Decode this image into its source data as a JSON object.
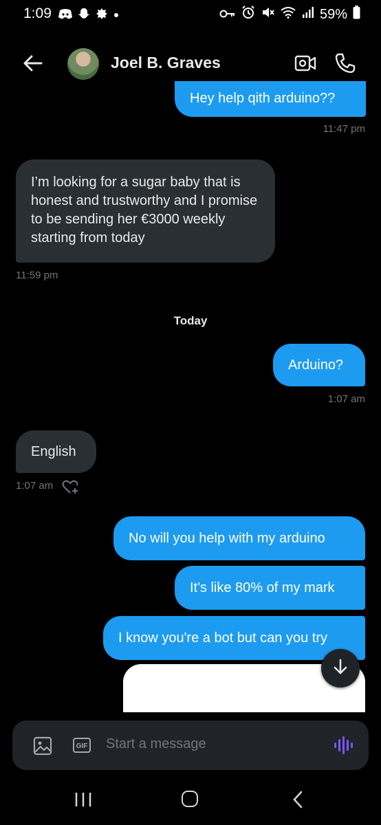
{
  "status_bar": {
    "time": "1:09",
    "battery": "59%"
  },
  "header": {
    "contact_name": "Joel B. Graves"
  },
  "messages": [
    {
      "text": "Hey help qith arduino??",
      "time": "11:47 pm"
    },
    {
      "text": "I’m looking for a sugar baby that is honest and trustworthy and I promise to be sending her €3000 weekly starting from today",
      "time": "11:59 pm"
    },
    {
      "text": "Arduino?",
      "time": "1:07 am"
    },
    {
      "text": "English",
      "time": "1:07 am"
    },
    {
      "text": "No will you help with my arduino"
    },
    {
      "text": "It's like 80% of my mark"
    },
    {
      "text": "I know you're a bot but can you try"
    }
  ],
  "day_divider": "Today",
  "composer": {
    "placeholder": "Start a message",
    "gif_label": "GIF"
  },
  "colors": {
    "accent": "#1d9bf0",
    "voice": "#7856ff"
  }
}
